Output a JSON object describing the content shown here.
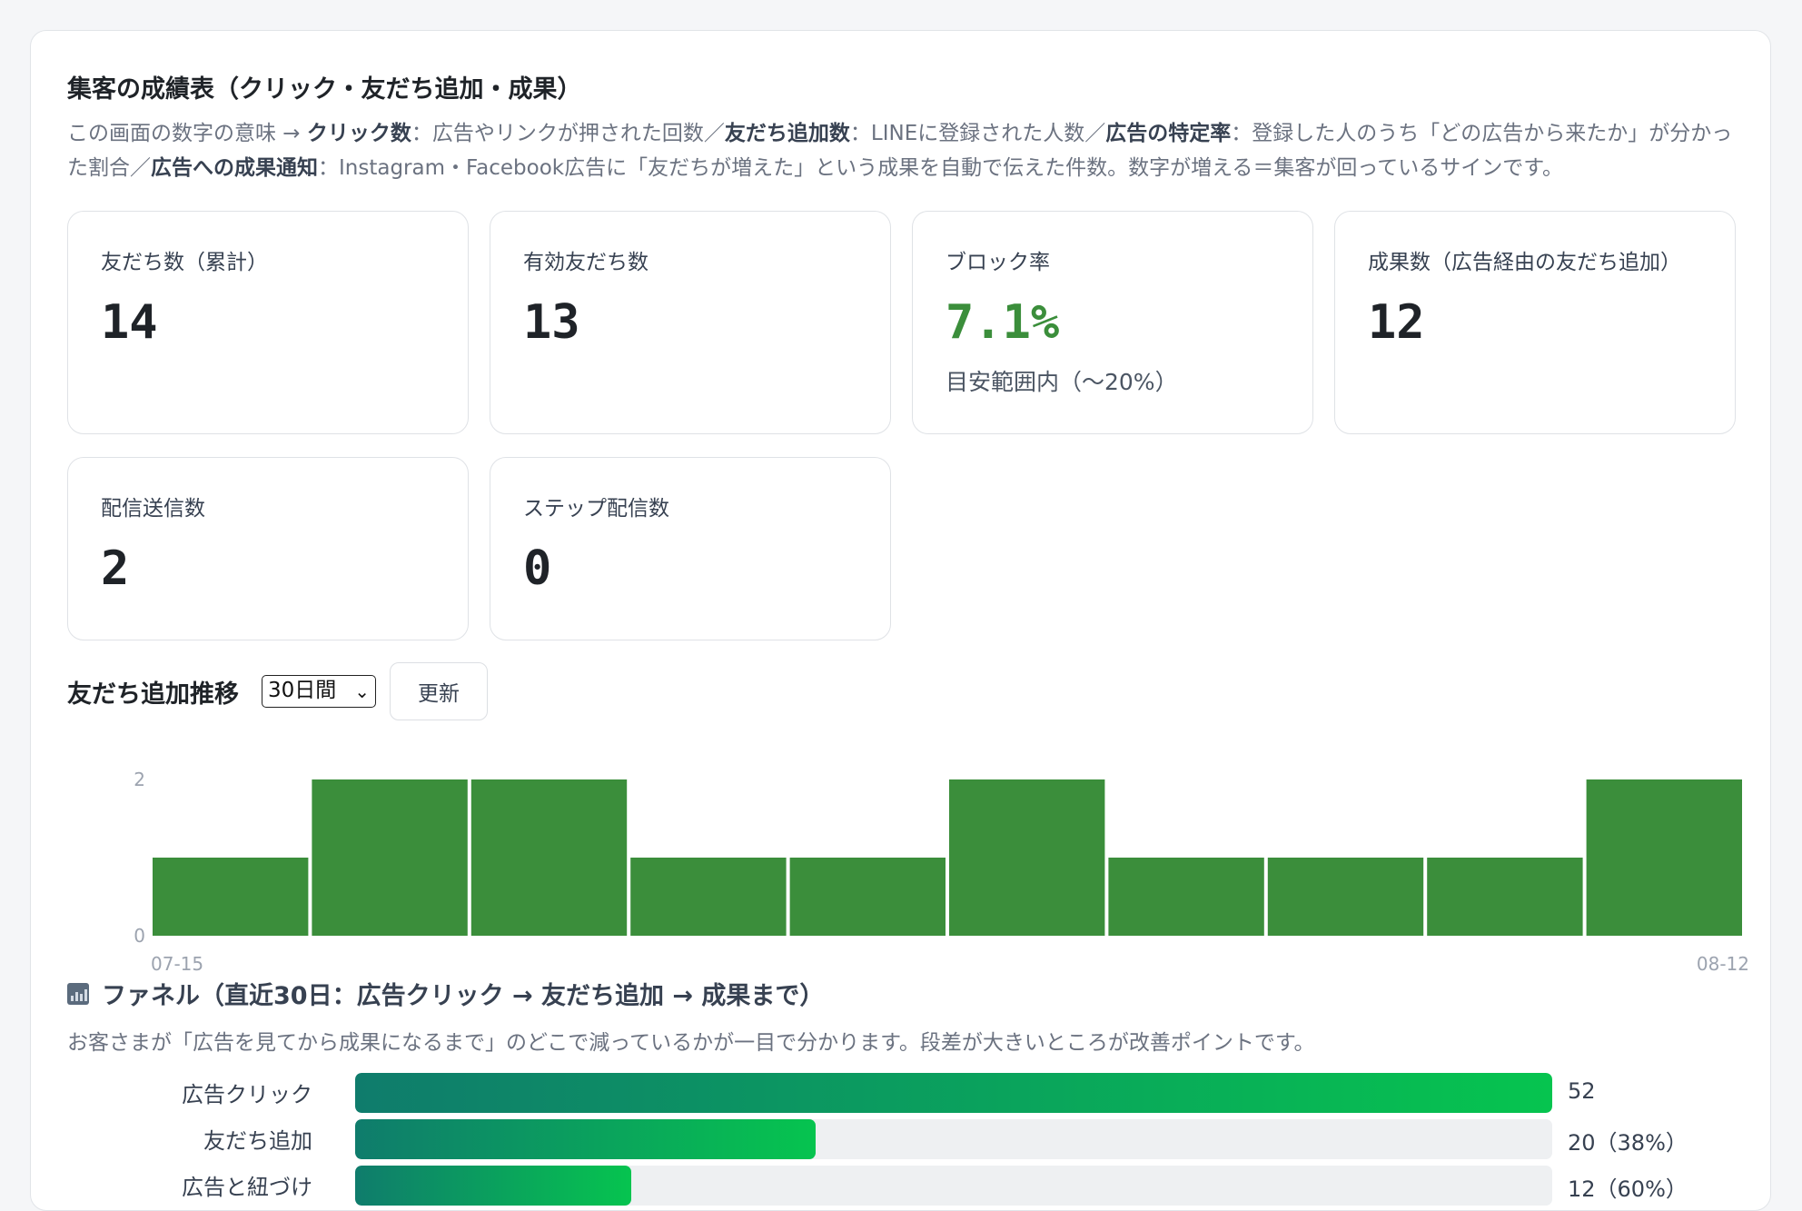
{
  "header": {
    "title": "集客の成績表（クリック・友だち追加・成果）",
    "desc_intro": "この画面の数字の意味 → ",
    "desc_terms": [
      {
        "term": "クリック数",
        "text": "：広告やリンクが押された回数／"
      },
      {
        "term": "友だち追加数",
        "text": "：LINEに登録された人数／"
      },
      {
        "term": "広告の特定率",
        "text": "：登録した人のうち「どの広告から来たか」が分かった割合／"
      },
      {
        "term": "広告への成果通知",
        "text": "：Instagram・Facebook広告に「友だちが増えた」という成果を自動で伝えた件数。数字が増える＝集客が回っているサインです。"
      }
    ]
  },
  "cards": [
    {
      "label": "友だち数（累計）",
      "value": "14"
    },
    {
      "label": "有効友だち数",
      "value": "13"
    },
    {
      "label": "ブロック率",
      "value": "7.1%",
      "note": "目安範囲内（〜20%）",
      "value_color": "#3b8e3b"
    },
    {
      "label": "成果数（広告経由の友だち追加）",
      "value": "12"
    },
    {
      "label": "配信送信数",
      "value": "2"
    },
    {
      "label": "ステップ配信数",
      "value": "0"
    }
  ],
  "trend": {
    "title": "友だち追加推移",
    "range_selected": "30日間",
    "refresh_label": "更新"
  },
  "chart_data": {
    "type": "bar",
    "categories": [
      "07-15",
      "",
      "",
      "",
      "",
      "",
      "",
      "",
      "",
      "08-12"
    ],
    "values": [
      1,
      2,
      2,
      1,
      1,
      2,
      1,
      1,
      1,
      2
    ],
    "ylim": [
      0,
      2
    ],
    "yticks": [
      "0",
      "2"
    ],
    "grid": false,
    "bar_color": "#3b8e3b"
  },
  "funnel": {
    "title": "ファネル（直近30日：広告クリック → 友だち追加 → 成果まで）",
    "desc": "お客さまが「広告を見てから成果になるまで」のどこで減っているかが一目で分かります。段差が大きいところが改善ポイントです。",
    "rows": [
      {
        "label": "広告クリック",
        "value": 52,
        "display": "52"
      },
      {
        "label": "友だち追加",
        "value": 20,
        "display": "20（38%）"
      },
      {
        "label": "広告と紐づけ",
        "value": 12,
        "display": "12（60%）"
      }
    ]
  }
}
